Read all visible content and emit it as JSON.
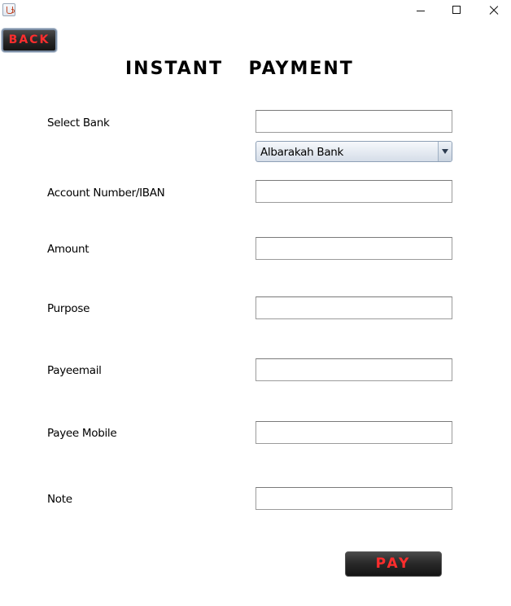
{
  "window": {
    "icon": "java-cup-icon",
    "controls": [
      "minimize-icon",
      "maximize-icon",
      "close-icon"
    ]
  },
  "back_button": {
    "label": "BACK"
  },
  "page_title": "INSTANT  PAYMENT",
  "form": {
    "select_bank": {
      "label": "Select Bank",
      "value": ""
    },
    "bank_dropdown": {
      "selected": "Albarakah Bank"
    },
    "account": {
      "label": "Account Number/IBAN",
      "value": ""
    },
    "amount": {
      "label": "Amount",
      "value": ""
    },
    "purpose": {
      "label": "Purpose",
      "value": ""
    },
    "payee_email": {
      "label": "Payeemail",
      "value": ""
    },
    "payee_mobile": {
      "label": "Payee Mobile",
      "value": ""
    },
    "note": {
      "label": "Note",
      "value": ""
    }
  },
  "pay_button": {
    "label": "PAY"
  },
  "colors": {
    "button_text": "#ff2d2d",
    "button_bg": "#2a2a2a",
    "accent_border": "#7b8da4"
  }
}
